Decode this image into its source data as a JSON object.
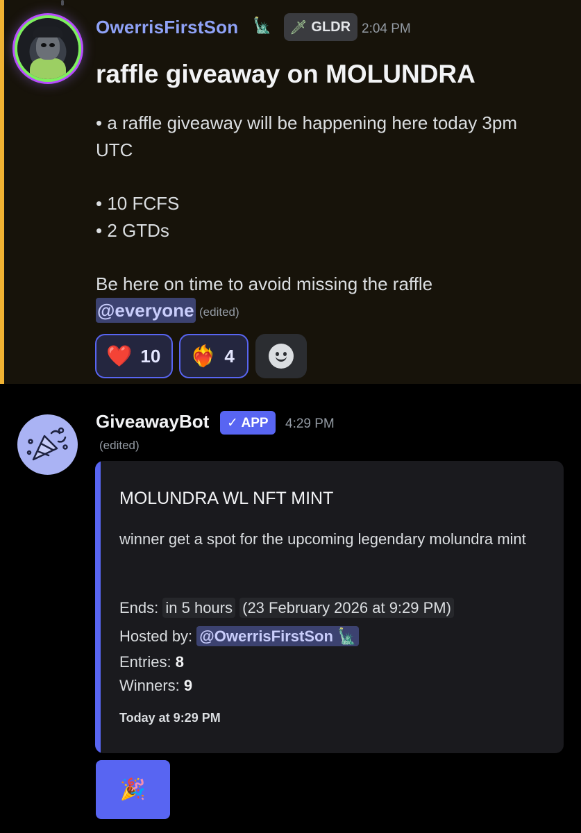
{
  "message1": {
    "author": "OwerrisFirstSon",
    "author_emoji": "🗽",
    "role_tag_icon": "🗡",
    "role_tag": "GLDR",
    "time": "2:04 PM",
    "title": "raffle giveaway on MOLUNDRA",
    "lines": [
      "• a raffle giveaway will be happening here today 3pm",
      "UTC",
      "• 10 FCFS",
      "• 2 GTDs",
      "Be here on time to avoid missing the raffle"
    ],
    "mention": "@everyone",
    "edited": "(edited)",
    "reactions": [
      {
        "emoji": "❤️",
        "count": "10"
      },
      {
        "emoji": "❤️‍🔥",
        "count": "4"
      }
    ],
    "add_reaction_icon": "smile-icon",
    "highlight_color": "#f0b232"
  },
  "message2": {
    "author": "GiveawayBot",
    "app_badge": "✓ APP",
    "time": "4:29 PM",
    "edited": "(edited)",
    "embed": {
      "title": "MOLUNDRA WL NFT MINT",
      "description": "winner get a spot for the upcoming legendary molundra mint",
      "ends_label": "Ends: ",
      "ends_relative": "in 5 hours",
      "ends_absolute": "(23 February 2026 at 9:29 PM)",
      "hosted_label": "Hosted by: ",
      "hosted_by": "@OwerrisFirstSon 🗽",
      "entries_label": "Entries: ",
      "entries": "8",
      "winners_label": "Winners: ",
      "winners": "9",
      "footer": "Today at 9:29 PM",
      "accent_color": "#5865f2"
    },
    "button_emoji": "🎉"
  }
}
